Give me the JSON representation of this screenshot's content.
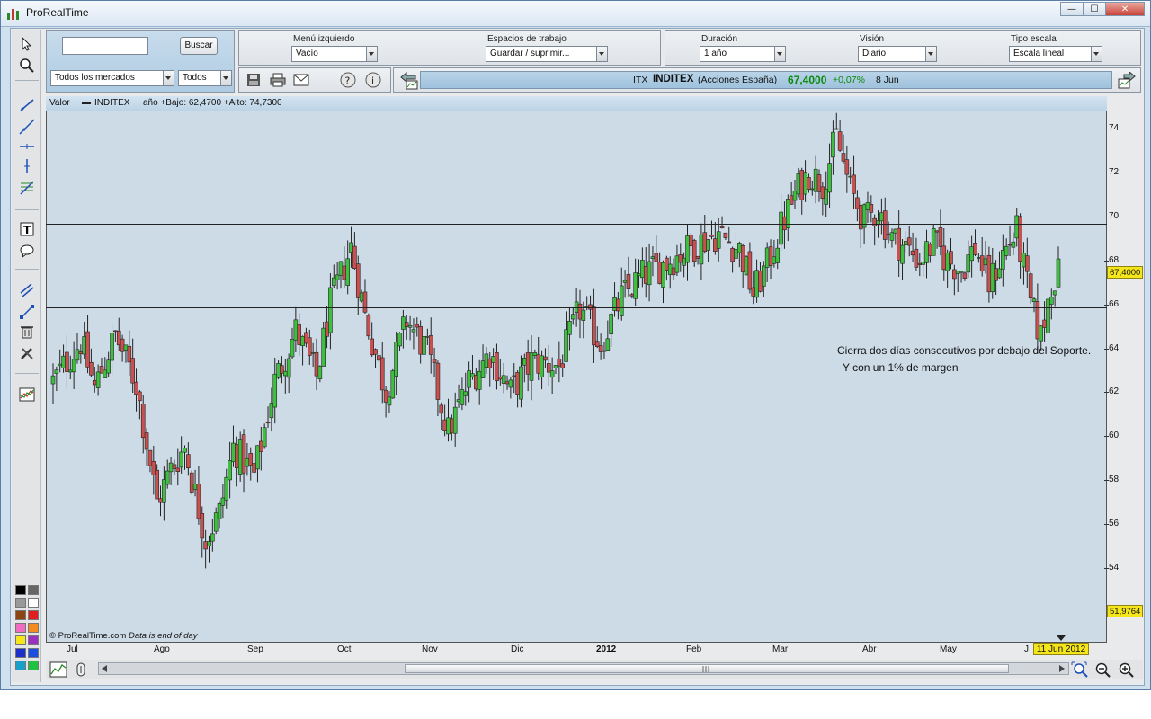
{
  "window": {
    "title": "ProRealTime",
    "minimize": "—",
    "maximize": "☐",
    "close": "✕"
  },
  "search": {
    "value": "",
    "button": "Buscar"
  },
  "market_filter": {
    "market": "Todos los mercados",
    "type": "Todos"
  },
  "menus": {
    "menu_izquierdo": {
      "label": "Menú izquierdo",
      "value": "Vacío"
    },
    "espacios": {
      "label": "Espacios de trabajo",
      "value": "Guardar / suprimir..."
    },
    "duracion": {
      "label": "Duración",
      "value": "1 año"
    },
    "vision": {
      "label": "Visión",
      "value": "Diario"
    },
    "tipo_escala": {
      "label": "Tipo escala",
      "value": "Escala lineal"
    }
  },
  "ticker": {
    "code": "ITX",
    "name": "INDITEX",
    "market": "(Acciones España)",
    "price": "67,4000",
    "change": "+0,07%",
    "date": "8 Jun"
  },
  "chart_header": {
    "valor": "Valor",
    "instrument": "INDITEX",
    "info": "año +Bajo: 62,4700 +Alto: 74,7300"
  },
  "annotations": {
    "line1": "Cierra dos días consecutivos por debajo del Soporte.",
    "line2": "Y con un 1% de margen"
  },
  "price_tags": {
    "current": "67,4000",
    "low": "51,9764"
  },
  "credit": {
    "site": "© ProRealTime.com",
    "note": "Data is end of day"
  },
  "date_badge": "11 Jun 2012",
  "chart_data": {
    "type": "candlestick",
    "instrument": "INDITEX",
    "timeframe": "Diario",
    "y_ticks": [
      54,
      56,
      58,
      60,
      62,
      64,
      66,
      68,
      70,
      72,
      74
    ],
    "ylim": [
      51.4,
      74.8
    ],
    "x_labels": [
      "Jul",
      "Ago",
      "Sep",
      "Oct",
      "Nov",
      "Dic",
      "2012",
      "Feb",
      "Mar",
      "Abr",
      "May",
      "J"
    ],
    "support_resistance": [
      65.8,
      69.6
    ],
    "anchors": [
      {
        "i": 0,
        "v": 62.5
      },
      {
        "i": 8,
        "v": 64.3
      },
      {
        "i": 12,
        "v": 62.2
      },
      {
        "i": 18,
        "v": 64.6
      },
      {
        "i": 24,
        "v": 62.4
      },
      {
        "i": 30,
        "v": 57.0
      },
      {
        "i": 34,
        "v": 58.5
      },
      {
        "i": 38,
        "v": 59.5
      },
      {
        "i": 44,
        "v": 55.3
      },
      {
        "i": 48,
        "v": 56.5
      },
      {
        "i": 52,
        "v": 59.5
      },
      {
        "i": 58,
        "v": 58.2
      },
      {
        "i": 64,
        "v": 62.5
      },
      {
        "i": 70,
        "v": 64.8
      },
      {
        "i": 76,
        "v": 62.7
      },
      {
        "i": 80,
        "v": 66.0
      },
      {
        "i": 86,
        "v": 68.6
      },
      {
        "i": 90,
        "v": 65.5
      },
      {
        "i": 96,
        "v": 62.0
      },
      {
        "i": 102,
        "v": 65.3
      },
      {
        "i": 108,
        "v": 63.8
      },
      {
        "i": 114,
        "v": 60.2
      },
      {
        "i": 120,
        "v": 62.5
      },
      {
        "i": 126,
        "v": 63.8
      },
      {
        "i": 132,
        "v": 62.0
      },
      {
        "i": 138,
        "v": 63.4
      },
      {
        "i": 146,
        "v": 63.2
      },
      {
        "i": 152,
        "v": 65.8
      },
      {
        "i": 158,
        "v": 64.2
      },
      {
        "i": 164,
        "v": 66.3
      },
      {
        "i": 170,
        "v": 67.3
      },
      {
        "i": 178,
        "v": 68.0
      },
      {
        "i": 186,
        "v": 68.8
      },
      {
        "i": 192,
        "v": 69.2
      },
      {
        "i": 198,
        "v": 68.5
      },
      {
        "i": 202,
        "v": 66.5
      },
      {
        "i": 206,
        "v": 67.8
      },
      {
        "i": 210,
        "v": 69.5
      },
      {
        "i": 214,
        "v": 71.0
      },
      {
        "i": 218,
        "v": 72.0
      },
      {
        "i": 222,
        "v": 71.5
      },
      {
        "i": 226,
        "v": 73.6
      },
      {
        "i": 230,
        "v": 71.2
      },
      {
        "i": 234,
        "v": 69.8
      },
      {
        "i": 238,
        "v": 70.3
      },
      {
        "i": 242,
        "v": 69.0
      },
      {
        "i": 246,
        "v": 68.6
      },
      {
        "i": 250,
        "v": 68.0
      },
      {
        "i": 254,
        "v": 68.8
      },
      {
        "i": 258,
        "v": 68.0
      },
      {
        "i": 262,
        "v": 67.6
      },
      {
        "i": 266,
        "v": 68.6
      },
      {
        "i": 270,
        "v": 66.9
      },
      {
        "i": 274,
        "v": 68.3
      },
      {
        "i": 278,
        "v": 69.3
      },
      {
        "i": 282,
        "v": 66.0
      },
      {
        "i": 285,
        "v": 64.5
      },
      {
        "i": 288,
        "v": 67.0
      },
      {
        "i": 290,
        "v": 67.4
      }
    ],
    "candle_count": 291
  }
}
